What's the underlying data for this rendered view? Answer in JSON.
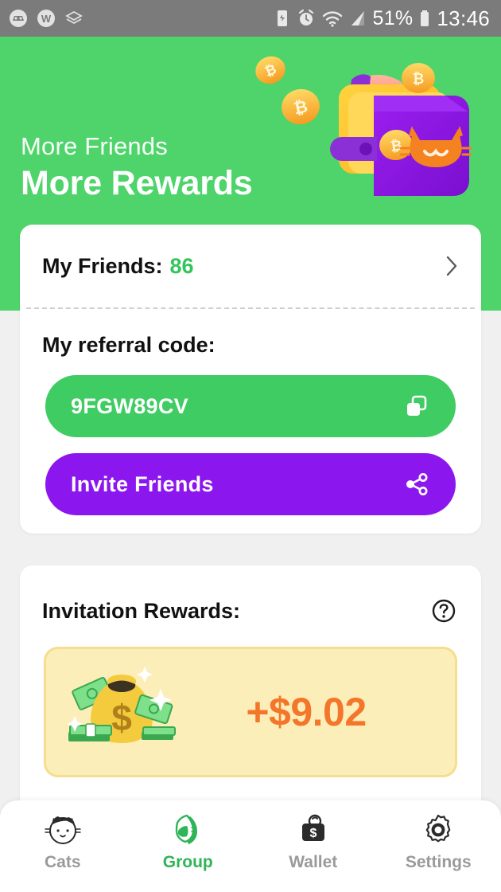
{
  "statusbar": {
    "left_icons": [
      "game-controller-icon",
      "w-badge-icon",
      "layers-icon"
    ],
    "right_icons": [
      "battery-saver-icon",
      "alarm-clock-icon",
      "wifi-icon",
      "signal-icon",
      "battery-icon"
    ],
    "battery_percent": "51%",
    "time": "13:46"
  },
  "header": {
    "subtitle": "More Friends",
    "title": "More Rewards",
    "background_color": "#4ed46a",
    "illustration": "bitcoin-wallet-cat-illustration"
  },
  "friends_card": {
    "friends_label": "My Friends:",
    "friends_count": "86",
    "chevron": "chevron-right-icon",
    "referral_title": "My referral code:",
    "referral_code": "9FGW89CV",
    "copy_icon": "copy-icon",
    "copy_pill_color": "#3fcc63",
    "invite_label": "Invite Friends",
    "share_icon": "share-icon",
    "invite_pill_color": "#8c17ee"
  },
  "rewards_card": {
    "title": "Invitation Rewards:",
    "help_icon": "question-circle-icon",
    "money_icon": "money-bag-icon",
    "amount": "+$9.02",
    "amount_color": "#f4762a",
    "box_background": "#fceeb8"
  },
  "bottom_nav": {
    "active": "Group",
    "active_color": "#2fb457",
    "items": [
      {
        "label": "Cats",
        "icon": "cat-face-icon"
      },
      {
        "label": "Group",
        "icon": "cat-group-icon"
      },
      {
        "label": "Wallet",
        "icon": "wallet-icon"
      },
      {
        "label": "Settings",
        "icon": "gear-icon"
      }
    ]
  }
}
